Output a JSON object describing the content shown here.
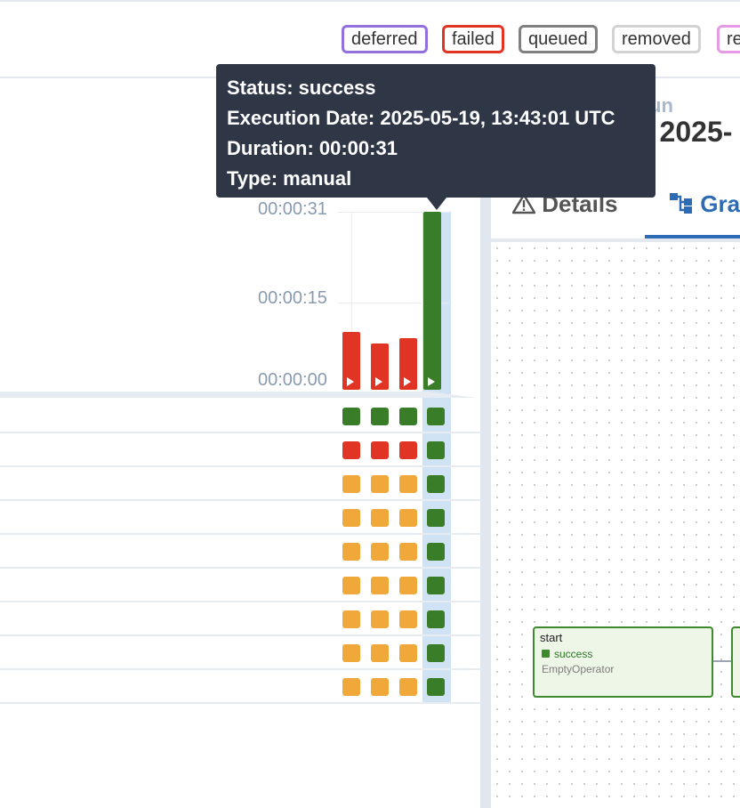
{
  "legend": [
    {
      "label": "deferred",
      "color": "#9370db"
    },
    {
      "label": "failed",
      "color": "#e03425"
    },
    {
      "label": "queued",
      "color": "#808080"
    },
    {
      "label": "removed",
      "color": "#d3d3d3"
    },
    {
      "label": "re",
      "color": "#e79be2"
    }
  ],
  "axis": {
    "top": "00:00:31",
    "mid": "00:00:15",
    "bottom": "00:00:00"
  },
  "colors": {
    "success": "#3a7d29",
    "failed": "#e03425",
    "upstream_failed": "#f0a83a",
    "selected": "#cfe3f5"
  },
  "runs": [
    {
      "state": "failed",
      "duration_seconds": 10
    },
    {
      "state": "failed",
      "duration_seconds": 8
    },
    {
      "state": "failed",
      "duration_seconds": 9
    },
    {
      "state": "success",
      "duration_seconds": 31,
      "selected": true
    }
  ],
  "task_rows": [
    [
      "success",
      "success",
      "success",
      "success"
    ],
    [
      "failed",
      "failed",
      "failed",
      "success"
    ],
    [
      "upstream_failed",
      "upstream_failed",
      "upstream_failed",
      "success"
    ],
    [
      "upstream_failed",
      "upstream_failed",
      "upstream_failed",
      "success"
    ],
    [
      "upstream_failed",
      "upstream_failed",
      "upstream_failed",
      "success"
    ],
    [
      "upstream_failed",
      "upstream_failed",
      "upstream_failed",
      "success"
    ],
    [
      "upstream_failed",
      "upstream_failed",
      "upstream_failed",
      "success"
    ],
    [
      "upstream_failed",
      "upstream_failed",
      "upstream_failed",
      "success"
    ],
    [
      "upstream_failed",
      "upstream_failed",
      "upstream_failed",
      "success"
    ]
  ],
  "tooltip": {
    "status": "Status: success",
    "execution_date": "Execution Date: 2025-05-19, 13:43:01 UTC",
    "duration": "Duration: 00:00:31",
    "type": "Type: manual"
  },
  "right_pane": {
    "run_label": "un",
    "run_date": "- 2025-",
    "tabs": {
      "details": "Details",
      "graph": "Gra"
    }
  },
  "graph": {
    "start_node": {
      "title": "start",
      "state": "success",
      "operator": "EmptyOperator"
    }
  }
}
